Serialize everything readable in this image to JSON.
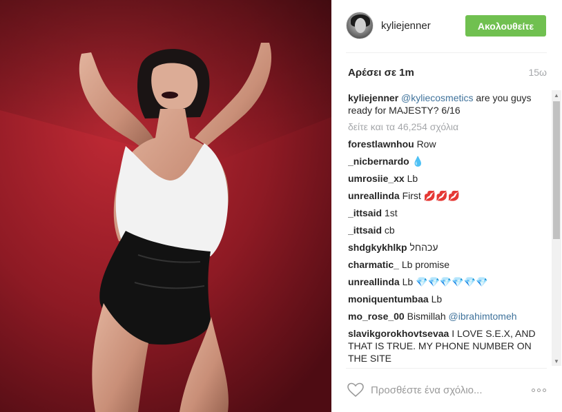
{
  "post": {
    "username": "kyliejenner",
    "follow_label": "Ακολουθείτε",
    "likes_label": "Αρέσει σε 1m",
    "time_label": "15ω",
    "caption": {
      "user": "kyliejenner",
      "mention": "@kyliecosmetics",
      "text": " are you guys ready for MAJESTY? 6/16"
    },
    "view_all_label": "δείτε και τα 46,254 σχόλια"
  },
  "comments": [
    {
      "user": "forestlawnhou",
      "text": "Row",
      "mention": ""
    },
    {
      "user": "_nicbernardo",
      "text": "💧",
      "mention": ""
    },
    {
      "user": "umrosiie_xx",
      "text": "Lb",
      "mention": ""
    },
    {
      "user": "unreallinda",
      "text": "First 💋💋💋",
      "mention": ""
    },
    {
      "user": "_ittsaid",
      "text": "1st",
      "mention": ""
    },
    {
      "user": "_ittsaid",
      "text": "cb",
      "mention": ""
    },
    {
      "user": "shdgkykhlkp",
      "text": "עכהחל",
      "mention": ""
    },
    {
      "user": "charmatic_",
      "text": "Lb promise",
      "mention": ""
    },
    {
      "user": "unreallinda",
      "text": "Lb 💎💎💎💎💎💎",
      "mention": ""
    },
    {
      "user": "moniquentumbaa",
      "text": "Lb",
      "mention": ""
    },
    {
      "user": "mo_rose_00",
      "text": "Bismillah",
      "mention": "@ibrahimtomeh"
    },
    {
      "user": "slavikgorokhovtsevaa",
      "text": "I LOVE S.E.X, AND THAT IS TRUE. MY PHONE NUMBER ON THE SITE",
      "mention": ""
    }
  ],
  "footer": {
    "comment_placeholder": "Προσθέστε ένα σχόλιο...",
    "heart_icon": "heart-outline-icon",
    "more_icon": "more-options-icon"
  },
  "colors": {
    "follow_button": "#70c050",
    "mention": "#3f729b",
    "muted": "#a5a7aa",
    "photo_background": "#8d1b24"
  }
}
